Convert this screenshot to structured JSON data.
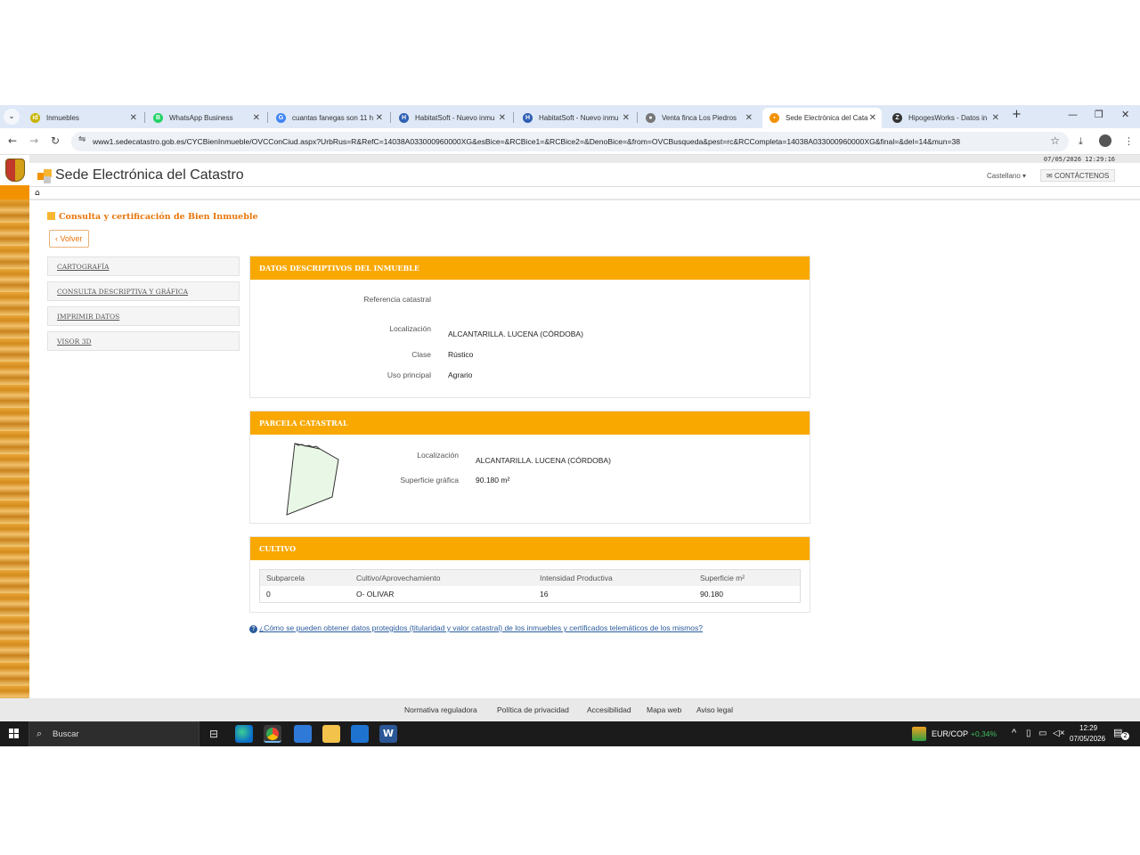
{
  "browser": {
    "tabs": [
      {
        "label": "Inmuebles",
        "fav": "id",
        "favColor": "#c8b400"
      },
      {
        "label": "WhatsApp Business",
        "fav": "B",
        "favColor": "#25d366"
      },
      {
        "label": "cuantas fanegas son 11 h",
        "fav": "G",
        "favColor": "#4285f4"
      },
      {
        "label": "HabitatSoft - Nuevo inmu",
        "fav": "H",
        "favColor": "#2f5fb3"
      },
      {
        "label": "HabitatSoft - Nuevo inmu",
        "fav": "H",
        "favColor": "#2f5fb3"
      },
      {
        "label": "Venta finca Los Piedros",
        "fav": "●",
        "favColor": "#777777"
      },
      {
        "label": "Sede Electrónica del Cata",
        "fav": "▪",
        "favColor": "#f39200"
      },
      {
        "label": "HipogesWorks - Datos in",
        "fav": "Z",
        "favColor": "#333333"
      }
    ],
    "tab_close_glyph": "✕",
    "new_tab_glyph": "+",
    "url": "www1.sedecatastro.gob.es/CYCBienInmueble/OVCConCiud.aspx?UrbRus=R&RefC=14038A033000960000XG&esBice=&RCBice1=&RCBice2=&DenoBice=&from=OVCBusqueda&pest=rc&RCCompleta=14038A033000960000XG&final=&del=14&mun=38"
  },
  "page": {
    "datetime": "07/05/2026  12:29:16",
    "site_title": "Sede Electrónica del Catastro",
    "language": "Castellano",
    "contact": "CONTÁCTENOS",
    "section_title": "Consulta y certificación de Bien Inmueble",
    "back_label": "Volver",
    "side_menu": [
      "CARTOGRAFÍA",
      "CONSULTA DESCRIPTIVA Y GRÁFICA",
      "IMPRIMIR DATOS",
      "VISOR 3D"
    ],
    "datos": {
      "header": "DATOS DESCRIPTIVOS DEL INMUEBLE",
      "ref_label": "Referencia catastral",
      "loc_label": "Localización",
      "loc_value": "ALCANTARILLA. LUCENA (CÓRDOBA)",
      "clase_label": "Clase",
      "clase_value": "Rústico",
      "uso_label": "Uso principal",
      "uso_value": "Agrario"
    },
    "parcela": {
      "header": "PARCELA CATASTRAL",
      "loc_label": "Localización",
      "loc_value": "ALCANTARILLA. LUCENA (CÓRDOBA)",
      "sup_label": "Superficie gráfica",
      "sup_value": "90.180 m²"
    },
    "cultivo": {
      "header": "CULTIVO",
      "columns": [
        "Subparcela",
        "Cultivo/Aprovechamiento",
        "Intensidad Productiva",
        "Superficie m²"
      ],
      "rows": [
        [
          "0",
          "O- OLIVAR",
          "16",
          "90.180"
        ]
      ]
    },
    "info_link": "¿Cómo se pueden obtener datos protegidos (titularidad y valor catastral) de los inmuebles y certificados telemáticos de los mismos?",
    "footer": [
      "Normativa reguladora",
      "Política de privacidad",
      "Accesibilidad",
      "Mapa web",
      "Aviso legal"
    ]
  },
  "taskbar": {
    "search": "Buscar",
    "ticker": "EUR/COP",
    "ticker_change": "+0,34%",
    "time": "12:29",
    "date": "07/05/2026",
    "notif_count": "2"
  }
}
